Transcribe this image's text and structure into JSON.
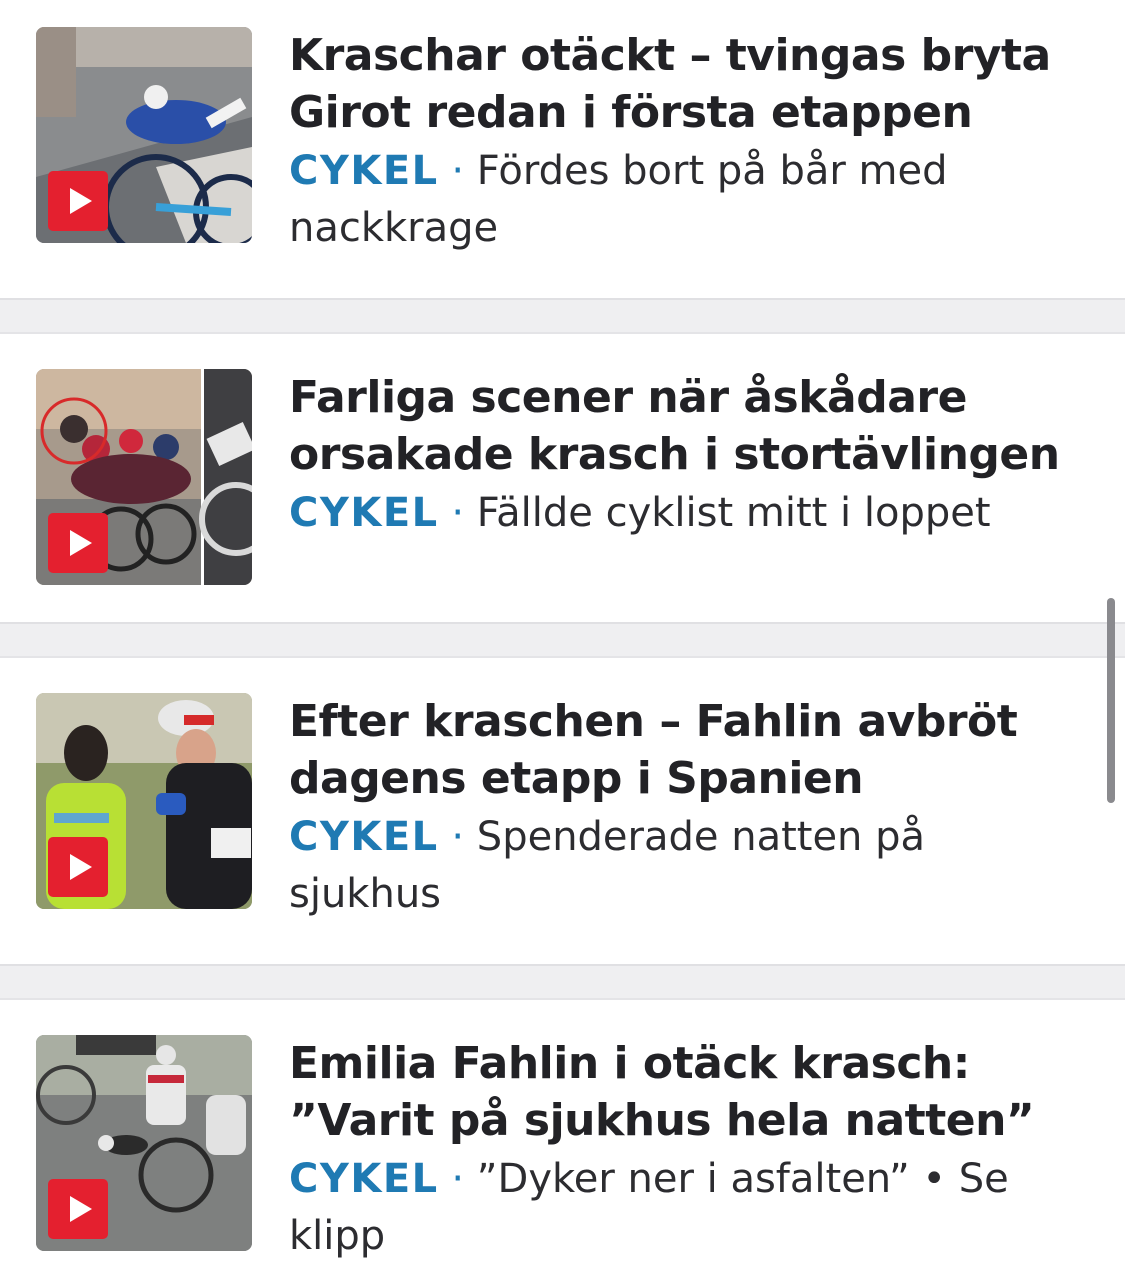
{
  "articles": [
    {
      "title_line1": "Kraschar otäckt – tvingas bryta",
      "title_line2": "Girot redan i första etappen",
      "category": "CYKEL",
      "separator": "·",
      "teaser": "Fördes bort på bår med nackkrage",
      "has_video": true
    },
    {
      "title_line1": "Farliga scener när åskådare",
      "title_line2": "orsakade krasch i stortävlingen",
      "category": "CYKEL",
      "separator": "·",
      "teaser": "Fällde cyklist mitt i loppet",
      "has_video": true
    },
    {
      "title_line1": "Efter kraschen – Fahlin avbröt",
      "title_line2": "dagens etapp i Spanien",
      "category": "CYKEL",
      "separator": "·",
      "teaser": "Spenderade natten på sjukhus",
      "has_video": true
    },
    {
      "title_line1": "Emilia Fahlin i otäck krasch:",
      "title_line2": "”Varit på sjukhus hela natten”",
      "category": "CYKEL",
      "separator": "·",
      "teaser": "”Dyker ner i asfalten” • Se klipp",
      "has_video": true
    }
  ],
  "colors": {
    "category": "#1f7ab3",
    "play_button": "#e4202f",
    "divider": "#efeff1",
    "title": "#222226"
  },
  "icons": {
    "video_badge": "play-icon"
  }
}
